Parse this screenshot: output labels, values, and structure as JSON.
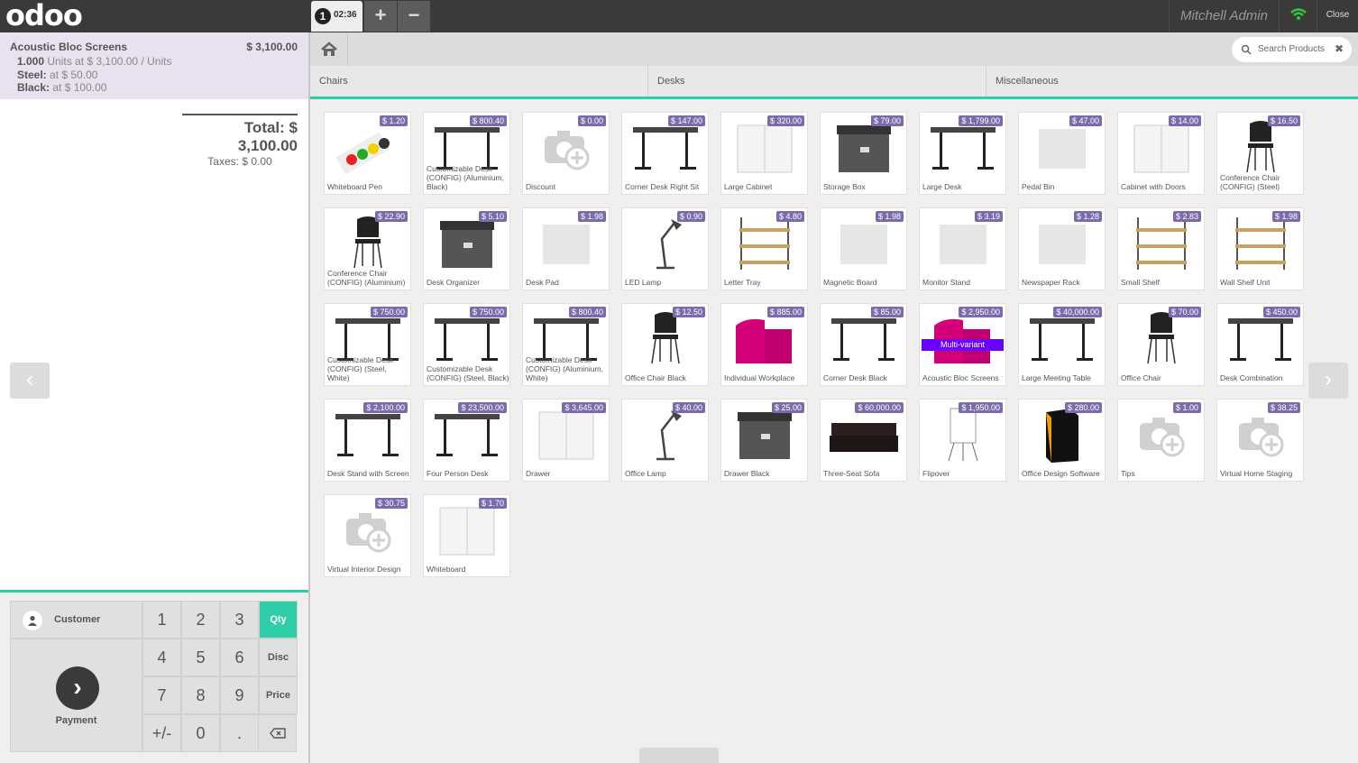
{
  "brand": {
    "logo": "odoo"
  },
  "order_tab": {
    "number": "1",
    "time": "02:36"
  },
  "toolbar": {
    "add": "+",
    "remove": "−"
  },
  "user": {
    "name": "Mitchell Admin",
    "close": "Close"
  },
  "order": {
    "line_name": "Acoustic Bloc Screens",
    "line_price": "$ 3,100.00",
    "qty": "1.000",
    "qty_suffix": "Units at $ 3,100.00 / Units",
    "attr1_name": "Steel:",
    "attr1_val": "at $ 50.00",
    "attr2_name": "Black:",
    "attr2_val": "at $ 100.00",
    "total": "Total: $ 3,100.00",
    "taxes": "Taxes: $ 0.00"
  },
  "pad": {
    "customer": "Customer",
    "payment": "Payment",
    "keys": [
      "1",
      "2",
      "3",
      "Qty",
      "4",
      "5",
      "6",
      "Disc",
      "7",
      "8",
      "9",
      "Price",
      "+/-",
      "0",
      "."
    ]
  },
  "search": {
    "placeholder": "Search Products"
  },
  "categories": [
    "Chairs",
    "Desks",
    "Miscellaneous"
  ],
  "products": [
    {
      "name": "Whiteboard Pen",
      "price": "$ 1.20"
    },
    {
      "name": "Customizable Desk (CONFIG) (Aluminium, Black)",
      "price": "$ 800.40"
    },
    {
      "name": "Discount",
      "price": "$ 0.00"
    },
    {
      "name": "Corner Desk Right Sit",
      "price": "$ 147.00"
    },
    {
      "name": "Large Cabinet",
      "price": "$ 320.00"
    },
    {
      "name": "Storage Box",
      "price": "$ 79.00"
    },
    {
      "name": "Large Desk",
      "price": "$ 1,799.00"
    },
    {
      "name": "Pedal Bin",
      "price": "$ 47.00"
    },
    {
      "name": "Cabinet with Doors",
      "price": "$ 14.00"
    },
    {
      "name": "Conference Chair (CONFIG) (Steel)",
      "price": "$ 16.50"
    },
    {
      "name": "Conference Chair (CONFIG) (Aluminium)",
      "price": "$ 22.90"
    },
    {
      "name": "Desk Organizer",
      "price": "$ 5.10"
    },
    {
      "name": "Desk Pad",
      "price": "$ 1.98"
    },
    {
      "name": "LED Lamp",
      "price": "$ 0.90"
    },
    {
      "name": "Letter Tray",
      "price": "$ 4.80"
    },
    {
      "name": "Magnetic Board",
      "price": "$ 1.98"
    },
    {
      "name": "Monitor Stand",
      "price": "$ 3.19"
    },
    {
      "name": "Newspaper Rack",
      "price": "$ 1.28"
    },
    {
      "name": "Small Shelf",
      "price": "$ 2.83"
    },
    {
      "name": "Wall Shelf Unit",
      "price": "$ 1.98"
    },
    {
      "name": "Customizable Desk (CONFIG) (Steel, White)",
      "price": "$ 750.00"
    },
    {
      "name": "Customizable Desk (CONFIG) (Steel, Black)",
      "price": "$ 750.00"
    },
    {
      "name": "Customizable Desk (CONFIG) (Aluminium, White)",
      "price": "$ 800.40"
    },
    {
      "name": "Office Chair Black",
      "price": "$ 12.50"
    },
    {
      "name": "Individual Workplace",
      "price": "$ 885.00"
    },
    {
      "name": "Corner Desk Black",
      "price": "$ 85.00"
    },
    {
      "name": "Acoustic Bloc Screens",
      "price": "$ 2,950.00",
      "tag": "Multi-variant"
    },
    {
      "name": "Large Meeting Table",
      "price": "$ 40,000.00"
    },
    {
      "name": "Office Chair",
      "price": "$ 70.00"
    },
    {
      "name": "Desk Combination",
      "price": "$ 450.00"
    },
    {
      "name": "Desk Stand with Screen",
      "price": "$ 2,100.00"
    },
    {
      "name": "Four Person Desk",
      "price": "$ 23,500.00"
    },
    {
      "name": "Drawer",
      "price": "$ 3,645.00"
    },
    {
      "name": "Office Lamp",
      "price": "$ 40.00"
    },
    {
      "name": "Drawer Black",
      "price": "$ 25.00"
    },
    {
      "name": "Three-Seat Sofa",
      "price": "$ 60,000.00"
    },
    {
      "name": "Flipover",
      "price": "$ 1,950.00"
    },
    {
      "name": "Office Design Software",
      "price": "$ 280.00"
    },
    {
      "name": "Tips",
      "price": "$ 1.00"
    },
    {
      "name": "Virtual Home Staging",
      "price": "$ 38.25"
    },
    {
      "name": "Virtual Interior Design",
      "price": "$ 30.75"
    },
    {
      "name": "Whiteboard",
      "price": "$ 1.70"
    }
  ],
  "nav": {
    "prev": "‹",
    "next": "›"
  },
  "colors": {
    "accent": "#2ecda7",
    "price_badge": "#7c6bab",
    "topbar": "#3a3a3a",
    "multivariant": "#6a00ff"
  }
}
